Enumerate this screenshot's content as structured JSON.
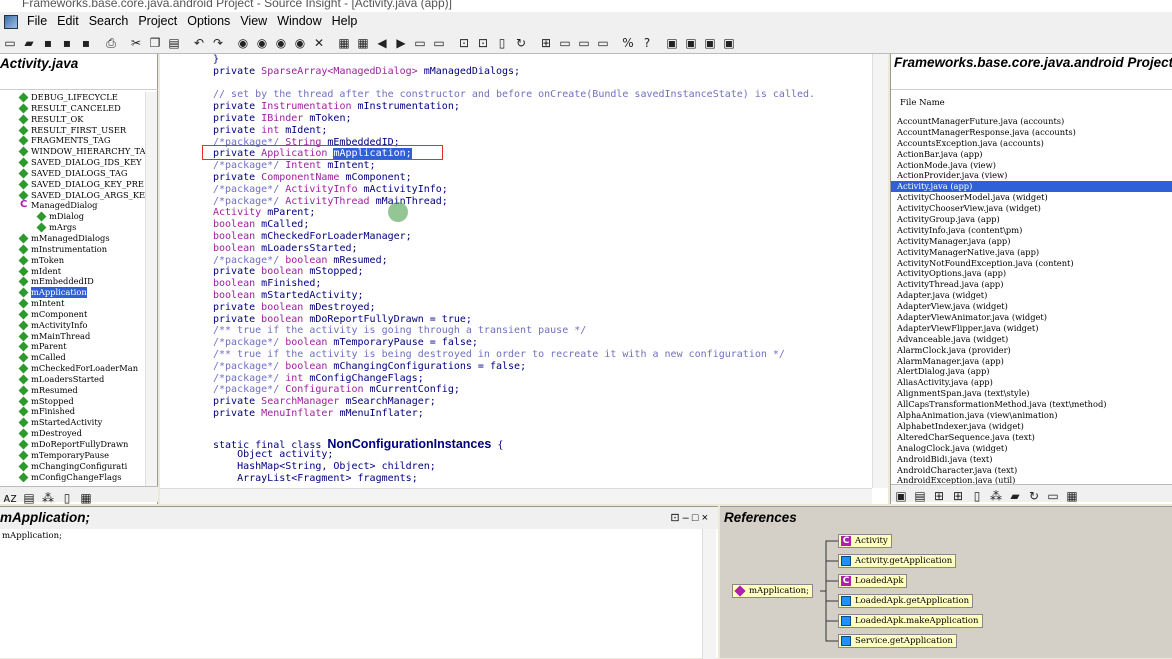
{
  "window": {
    "title": "Frameworks.base.core.java.android Project - Source Insight - [Activity.java (app)]"
  },
  "menu": [
    "File",
    "Edit",
    "Search",
    "Project",
    "Options",
    "View",
    "Window",
    "Help"
  ],
  "left_panel": {
    "title": "Activity.java",
    "symbols": [
      {
        "label": "DEBUG_LIFECYCLE",
        "kind": "field",
        "indent": 0
      },
      {
        "label": "RESULT_CANCELED",
        "kind": "field",
        "indent": 0
      },
      {
        "label": "RESULT_OK",
        "kind": "field",
        "indent": 0
      },
      {
        "label": "RESULT_FIRST_USER",
        "kind": "field",
        "indent": 0
      },
      {
        "label": "FRAGMENTS_TAG",
        "kind": "field",
        "indent": 0
      },
      {
        "label": "WINDOW_HIERARCHY_TAG",
        "kind": "field",
        "indent": 0
      },
      {
        "label": "SAVED_DIALOG_IDS_KEY",
        "kind": "field",
        "indent": 0
      },
      {
        "label": "SAVED_DIALOGS_TAG",
        "kind": "field",
        "indent": 0
      },
      {
        "label": "SAVED_DIALOG_KEY_PRE",
        "kind": "field",
        "indent": 0
      },
      {
        "label": "SAVED_DIALOG_ARGS_KE",
        "kind": "field",
        "indent": 0
      },
      {
        "label": "ManagedDialog",
        "kind": "class",
        "indent": 0
      },
      {
        "label": "mDialog",
        "kind": "field",
        "indent": 1
      },
      {
        "label": "mArgs",
        "kind": "field",
        "indent": 1
      },
      {
        "label": "mManagedDialogs",
        "kind": "field",
        "indent": 0
      },
      {
        "label": "mInstrumentation",
        "kind": "field",
        "indent": 0
      },
      {
        "label": "mToken",
        "kind": "field",
        "indent": 0
      },
      {
        "label": "mIdent",
        "kind": "field",
        "indent": 0
      },
      {
        "label": "mEmbeddedID",
        "kind": "field",
        "indent": 0
      },
      {
        "label": "mApplication",
        "kind": "field",
        "indent": 0,
        "selected": true
      },
      {
        "label": "mIntent",
        "kind": "field",
        "indent": 0
      },
      {
        "label": "mComponent",
        "kind": "field",
        "indent": 0
      },
      {
        "label": "mActivityInfo",
        "kind": "field",
        "indent": 0
      },
      {
        "label": "mMainThread",
        "kind": "field",
        "indent": 0
      },
      {
        "label": "mParent",
        "kind": "field",
        "indent": 0
      },
      {
        "label": "mCalled",
        "kind": "field",
        "indent": 0
      },
      {
        "label": "mCheckedForLoaderMan",
        "kind": "field",
        "indent": 0
      },
      {
        "label": "mLoadersStarted",
        "kind": "field",
        "indent": 0
      },
      {
        "label": "mResumed",
        "kind": "field",
        "indent": 0
      },
      {
        "label": "mStopped",
        "kind": "field",
        "indent": 0
      },
      {
        "label": "mFinished",
        "kind": "field",
        "indent": 0
      },
      {
        "label": "mStartedActivity",
        "kind": "field",
        "indent": 0
      },
      {
        "label": "mDestroyed",
        "kind": "field",
        "indent": 0
      },
      {
        "label": "mDoReportFullyDrawn",
        "kind": "field",
        "indent": 0
      },
      {
        "label": "mTemporaryPause",
        "kind": "field",
        "indent": 0
      },
      {
        "label": "mChangingConfigurati",
        "kind": "field",
        "indent": 0
      },
      {
        "label": "mConfigChangeFlags",
        "kind": "field",
        "indent": 0
      }
    ]
  },
  "editor": {
    "lines": [
      [
        {
          "t": "}",
          "c": "kw"
        }
      ],
      [
        {
          "t": "private ",
          "c": "kw"
        },
        {
          "t": "SparseArray<ManagedDialog>",
          "c": "ty"
        },
        {
          "t": " mManagedDialogs;",
          "c": "kw"
        }
      ],
      [],
      [
        {
          "t": "// set by the thread after the constructor and before onCreate(Bundle savedInstanceState) is called.",
          "c": "cm"
        }
      ],
      [
        {
          "t": "private ",
          "c": "kw"
        },
        {
          "t": "Instrumentation",
          "c": "ty"
        },
        {
          "t": " mInstrumentation;",
          "c": "kw"
        }
      ],
      [
        {
          "t": "private ",
          "c": "kw"
        },
        {
          "t": "IBinder",
          "c": "ty"
        },
        {
          "t": " mToken;",
          "c": "kw"
        }
      ],
      [
        {
          "t": "private ",
          "c": "kw"
        },
        {
          "t": "int",
          "c": "ty"
        },
        {
          "t": " mIdent;",
          "c": "kw"
        }
      ],
      [
        {
          "t": "/*package*/ ",
          "c": "cm"
        },
        {
          "t": "String",
          "c": "ty"
        },
        {
          "t": " mEmbeddedID;",
          "c": "kw"
        }
      ],
      [
        {
          "t": "private ",
          "c": "kw"
        },
        {
          "t": "Application",
          "c": "ty"
        },
        {
          "t": " ",
          "c": "kw"
        },
        {
          "t": "mApplication;",
          "c": "hl"
        }
      ],
      [
        {
          "t": "/*package*/ ",
          "c": "cm"
        },
        {
          "t": "Intent",
          "c": "ty"
        },
        {
          "t": " mIntent;",
          "c": "kw"
        }
      ],
      [
        {
          "t": "private ",
          "c": "kw"
        },
        {
          "t": "ComponentName",
          "c": "ty"
        },
        {
          "t": " mComponent;",
          "c": "kw"
        }
      ],
      [
        {
          "t": "/*package*/ ",
          "c": "cm"
        },
        {
          "t": "ActivityInfo",
          "c": "ty"
        },
        {
          "t": " mActivityInfo;",
          "c": "kw"
        }
      ],
      [
        {
          "t": "/*package*/ ",
          "c": "cm"
        },
        {
          "t": "ActivityThread",
          "c": "ty"
        },
        {
          "t": " mMainThread;",
          "c": "kw"
        }
      ],
      [
        {
          "t": "Activity",
          "c": "ty"
        },
        {
          "t": " mParent;",
          "c": "kw"
        }
      ],
      [
        {
          "t": "boolean",
          "c": "ty"
        },
        {
          "t": " mCalled;",
          "c": "kw"
        }
      ],
      [
        {
          "t": "boolean",
          "c": "ty"
        },
        {
          "t": " mCheckedForLoaderManager;",
          "c": "kw"
        }
      ],
      [
        {
          "t": "boolean",
          "c": "ty"
        },
        {
          "t": " mLoadersStarted;",
          "c": "kw"
        }
      ],
      [
        {
          "t": "/*package*/ ",
          "c": "cm"
        },
        {
          "t": "boolean",
          "c": "ty"
        },
        {
          "t": " mResumed;",
          "c": "kw"
        }
      ],
      [
        {
          "t": "private ",
          "c": "kw"
        },
        {
          "t": "boolean",
          "c": "ty"
        },
        {
          "t": " mStopped;",
          "c": "kw"
        }
      ],
      [
        {
          "t": "boolean",
          "c": "ty"
        },
        {
          "t": " mFinished;",
          "c": "kw"
        }
      ],
      [
        {
          "t": "boolean",
          "c": "ty"
        },
        {
          "t": " mStartedActivity;",
          "c": "kw"
        }
      ],
      [
        {
          "t": "private ",
          "c": "kw"
        },
        {
          "t": "boolean",
          "c": "ty"
        },
        {
          "t": " mDestroyed;",
          "c": "kw"
        }
      ],
      [
        {
          "t": "private ",
          "c": "kw"
        },
        {
          "t": "boolean",
          "c": "ty"
        },
        {
          "t": " mDoReportFullyDrawn = true;",
          "c": "kw"
        }
      ],
      [
        {
          "t": "/** true if the activity is going through a transient pause */",
          "c": "cm"
        }
      ],
      [
        {
          "t": "/*package*/ ",
          "c": "cm"
        },
        {
          "t": "boolean",
          "c": "ty"
        },
        {
          "t": " mTemporaryPause = false;",
          "c": "kw"
        }
      ],
      [
        {
          "t": "/** true if the activity is being destroyed in order to recreate it with a new configuration */",
          "c": "cm"
        }
      ],
      [
        {
          "t": "/*package*/ ",
          "c": "cm"
        },
        {
          "t": "boolean",
          "c": "ty"
        },
        {
          "t": " mChangingConfigurations = false;",
          "c": "kw"
        }
      ],
      [
        {
          "t": "/*package*/ ",
          "c": "cm"
        },
        {
          "t": "int",
          "c": "ty"
        },
        {
          "t": " mConfigChangeFlags;",
          "c": "kw"
        }
      ],
      [
        {
          "t": "/*package*/ ",
          "c": "cm"
        },
        {
          "t": "Configuration",
          "c": "ty"
        },
        {
          "t": " mCurrentConfig;",
          "c": "kw"
        }
      ],
      [
        {
          "t": "private ",
          "c": "kw"
        },
        {
          "t": "SearchManager",
          "c": "ty"
        },
        {
          "t": " mSearchManager;",
          "c": "kw"
        }
      ],
      [
        {
          "t": "private ",
          "c": "kw"
        },
        {
          "t": "MenuInflater",
          "c": "ty"
        },
        {
          "t": " mMenuInflater;",
          "c": "kw"
        }
      ],
      [],
      [
        {
          "t": "static final class ",
          "c": "kw"
        },
        {
          "t": "NonConfigurationInstances",
          "c": "big"
        },
        {
          "t": " {",
          "c": "kw"
        }
      ],
      [
        {
          "t": "    Object",
          "c": "kw"
        },
        {
          "t": " activity;",
          "c": "kw"
        }
      ],
      [
        {
          "t": "    HashMap<String, Object>",
          "c": "kw"
        },
        {
          "t": " children;",
          "c": "kw"
        }
      ],
      [
        {
          "t": "    ArrayList<Fragment>",
          "c": "kw"
        },
        {
          "t": " fragments;",
          "c": "kw"
        }
      ]
    ]
  },
  "right_panel": {
    "title": "Frameworks.base.core.java.android Project",
    "column_header": "File Name",
    "files": [
      "AccountManagerFuture.java (accounts)",
      "AccountManagerResponse.java (accounts)",
      "AccountsException.java (accounts)",
      "ActionBar.java (app)",
      "ActionMode.java (view)",
      "ActionProvider.java (view)",
      "Activity.java (app)",
      "ActivityChooserModel.java (widget)",
      "ActivityChooserView.java (widget)",
      "ActivityGroup.java (app)",
      "ActivityInfo.java (content\\pm)",
      "ActivityManager.java (app)",
      "ActivityManagerNative.java (app)",
      "ActivityNotFoundException.java (content)",
      "ActivityOptions.java (app)",
      "ActivityThread.java (app)",
      "Adapter.java (widget)",
      "AdapterView.java (widget)",
      "AdapterViewAnimator.java (widget)",
      "AdapterViewFlipper.java (widget)",
      "Advanceable.java (widget)",
      "AlarmClock.java (provider)",
      "AlarmManager.java (app)",
      "AlertDialog.java (app)",
      "AliasActivity.java (app)",
      "AlignmentSpan.java (text\\style)",
      "AllCapsTransformationMethod.java (text\\method)",
      "AlphaAnimation.java (view\\animation)",
      "AlphabetIndexer.java (widget)",
      "AlteredCharSequence.java (text)",
      "AnalogClock.java (widget)",
      "AndroidBidi.java (text)",
      "AndroidCharacter.java (text)",
      "AndroidException.java (util)"
    ],
    "selected_file": "Activity.java (app)"
  },
  "context": {
    "title": "mApplication;",
    "text": "mApplication;",
    "buttons": [
      "⊡",
      "–",
      "□",
      "×"
    ]
  },
  "references": {
    "title": "References",
    "root": "mApplication;",
    "nodes": [
      {
        "label": "Activity",
        "kind": "class"
      },
      {
        "label": "Activity.getApplication",
        "kind": "fn"
      },
      {
        "label": "LoadedApk",
        "kind": "class"
      },
      {
        "label": "LoadedApk.getApplication",
        "kind": "fn"
      },
      {
        "label": "LoadedApk.makeApplication",
        "kind": "fn"
      },
      {
        "label": "Service.getApplication",
        "kind": "fn"
      }
    ]
  },
  "colors": {
    "selection": "#3060d8",
    "highlight_box": "#e03030",
    "keyword": "#000080",
    "type": "#a020a0",
    "comment": "#7070c0"
  }
}
